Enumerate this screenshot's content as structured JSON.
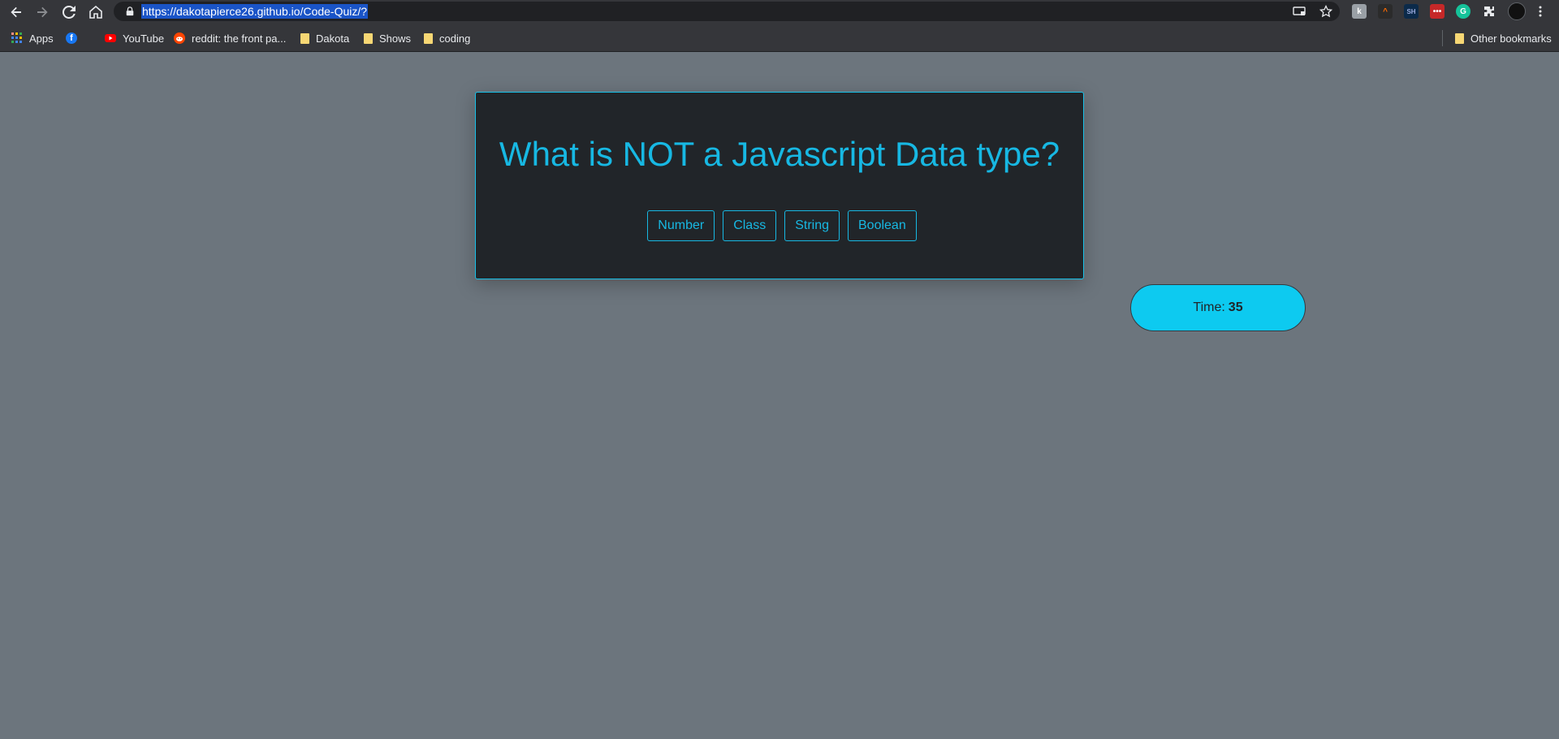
{
  "browser": {
    "url": "https://dakotapierce26.github.io/Code-Quiz/?",
    "nav_icons": [
      "back-icon",
      "forward-icon",
      "reload-icon",
      "home-icon"
    ],
    "omnibox_icons": [
      "lock-icon",
      "cast-icon",
      "star-icon"
    ],
    "extensions": [
      "extension-1",
      "extension-2",
      "extension-sh",
      "extension-4",
      "grammarly-icon",
      "puzzle-icon"
    ],
    "colors": {
      "toolbar": "#35363a",
      "omnibox": "#202124",
      "url_highlight": "#1a54c7"
    }
  },
  "bookmarks": {
    "items": [
      {
        "label": "Apps",
        "icon": "apps-grid-icon"
      },
      {
        "label": "",
        "icon": "facebook-icon"
      },
      {
        "label": "YouTube",
        "icon": "youtube-icon"
      },
      {
        "label": "reddit: the front pa...",
        "icon": "reddit-icon"
      },
      {
        "label": "Dakota",
        "icon": "folder-icon"
      },
      {
        "label": "Shows",
        "icon": "folder-icon"
      },
      {
        "label": "coding",
        "icon": "folder-icon"
      }
    ],
    "other": "Other bookmarks"
  },
  "quiz": {
    "question": "What is NOT a Javascript Data type?",
    "answers": [
      "Number",
      "Class",
      "String",
      "Boolean"
    ],
    "colors": {
      "accent": "#17b8e3",
      "card_bg": "#212529",
      "page_bg": "#6c757d"
    }
  },
  "timer": {
    "label": "Time:",
    "value": "35",
    "color": "#0dcaf0"
  }
}
